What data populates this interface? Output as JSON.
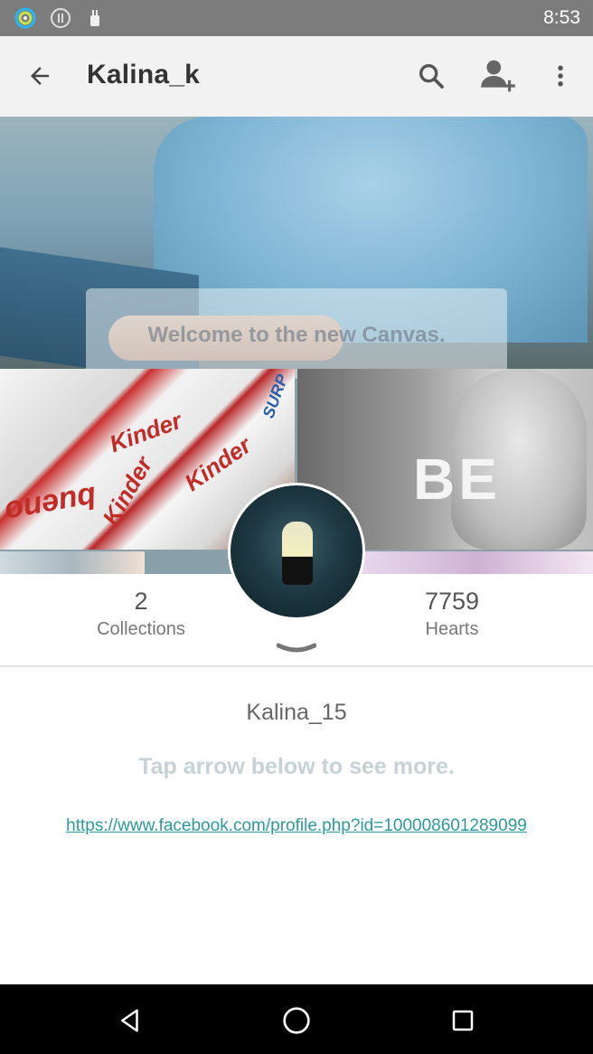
{
  "status_bar": {
    "time": "8:53",
    "icons": [
      "ring-icon",
      "pause-circle-icon",
      "android-icon"
    ]
  },
  "app_bar": {
    "title": "Kalina_k",
    "back_icon": "arrow-back-icon",
    "actions": [
      "search-icon",
      "add-person-icon",
      "more-vert-icon"
    ]
  },
  "cover": {
    "overlay_text": "Welcome to the new Canvas.",
    "kinder_texts": [
      "Kinder",
      "Kinder",
      "Kinder",
      "bueno",
      "SURP"
    ],
    "be_text": "BE"
  },
  "profile": {
    "collections_count": "2",
    "collections_label": "Collections",
    "hearts_count": "7759",
    "hearts_label": "Hearts",
    "username": "Kalina_15",
    "hint": "Tap arrow below to see more.",
    "link": "https://www.facebook.com/profile.php?id=100008601289099"
  },
  "colors": {
    "status_bar": "#7c7c7c",
    "app_bar": "#f2f2f2",
    "link": "#2a9a9e",
    "hint": "#c7d2d6",
    "nav_bar": "#000000"
  },
  "nav_bar": {
    "buttons": [
      "back-triangle-icon",
      "home-circle-icon",
      "recents-square-icon"
    ]
  }
}
